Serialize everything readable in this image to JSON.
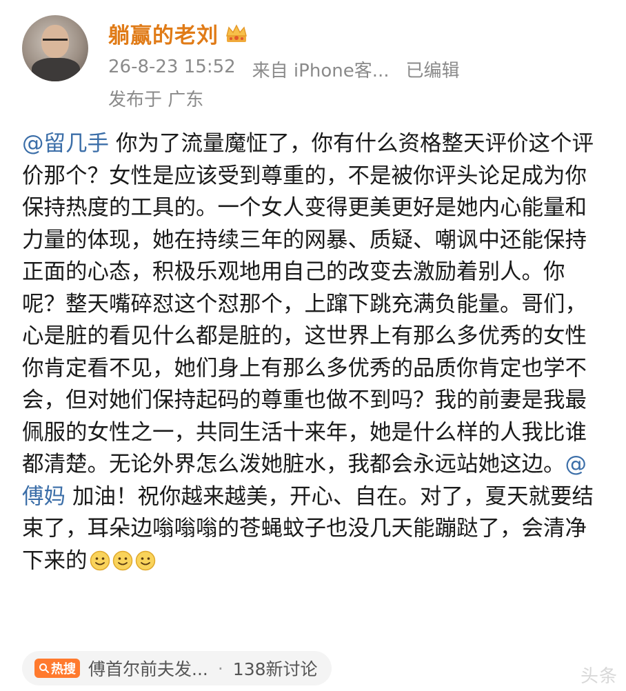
{
  "header": {
    "username": "躺赢的老刘",
    "crown_icon": "crown-icon",
    "timestamp": "26-8-23 15:52",
    "source": "来自 iPhone客...",
    "edited": "已编辑",
    "location": "发布于 广东"
  },
  "post": {
    "segments": [
      {
        "type": "mention",
        "text": "@留几手"
      },
      {
        "type": "text",
        "text": " 你为了流量魔怔了，你有什么资格整天评价这个评价那个？女性是应该受到尊重的，不是被你评头论足成为你保持热度的工具的。一个女人变得更美更好是她内心能量和力量的体现，她在持续三年的网暴、质疑、嘲讽中还能保持正面的心态，积极乐观地用自己的改变去激励着别人。你呢？整天嘴碎怼这个怼那个，上蹿下跳充满负能量。哥们，心是脏的看见什么都是脏的，这世界上有那么多优秀的女性你肯定看不见，她们身上有那么多优秀的品质你肯定也学不会，但对她们保持起码的尊重也做不到吗？我的前妻是我最佩服的女性之一，共同生活十来年，她是什么样的人我比谁都清楚。无论外界怎么泼她脏水，我都会永远站她这边。"
      },
      {
        "type": "mention",
        "text": "@傅妈"
      },
      {
        "type": "text",
        "text": " 加油！祝你越来越美，开心、自在。对了，夏天就要结束了，耳朵边嗡嗡嗡的苍蝇蚊子也没几天能蹦跶了，会清净下来的"
      }
    ],
    "emoji": [
      "smile-icon",
      "smile-icon",
      "smile-icon"
    ]
  },
  "hot_topic": {
    "badge": "热搜",
    "title": "傅首尔前夫发...",
    "separator": "·",
    "count": "138新讨论"
  },
  "watermark": "头条"
}
